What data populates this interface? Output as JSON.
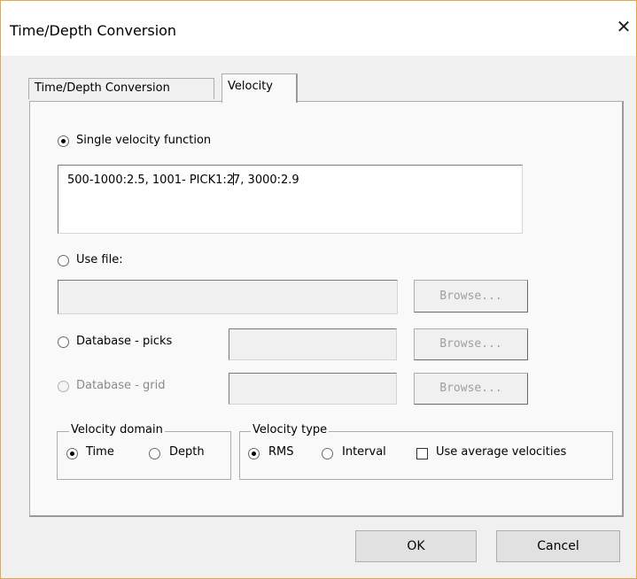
{
  "window": {
    "title": "Time/Depth Conversion",
    "close_glyph": "✕"
  },
  "tabs": [
    {
      "label": "Time/Depth Conversion",
      "active": false
    },
    {
      "label": "Velocity",
      "active": true
    }
  ],
  "velocity": {
    "single_function_label": "Single velocity function",
    "single_function_text_before_caret": "500-1000:2.5, 1001- PICK1:2",
    "single_function_text_after_caret": "7, 3000:2.9",
    "use_file_label": "Use file:",
    "use_file_value": "",
    "db_picks_label": "Database - picks",
    "db_picks_value": "",
    "db_grid_label": "Database - grid",
    "db_grid_value": "",
    "browse_label": "Browse...",
    "selected_source": "single_function"
  },
  "velocity_domain": {
    "legend": "Velocity domain",
    "options": [
      "Time",
      "Depth"
    ],
    "selected": "Time"
  },
  "velocity_type": {
    "legend": "Velocity type",
    "options": [
      "RMS",
      "Interval"
    ],
    "selected": "RMS",
    "use_average_label": "Use average velocities",
    "use_average_checked": false
  },
  "buttons": {
    "ok": "OK",
    "cancel": "Cancel"
  }
}
